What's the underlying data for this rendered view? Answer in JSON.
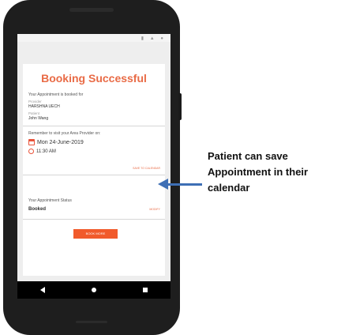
{
  "screen": {
    "title": "Booking Successful",
    "intro": "Your Appointment is booked for",
    "provider_label": "Provider",
    "provider_value": "HARSHNA UECH",
    "patient_label": "Patient",
    "patient_value": "John Wang",
    "reminder": "Remember to visit your Area Provider on:",
    "date": "Mon 24-June-2019",
    "time": "11:30 AM",
    "save_calendar": "SAVE TO CALENDAR",
    "status_label": "Your Appointment Status",
    "status_value": "Booked",
    "status_action": "MODIFY",
    "cta": "BOOK MORE"
  },
  "annotation": {
    "text": "Patient can save Appointment in their calendar"
  },
  "colors": {
    "accent": "#e96b46",
    "button": "#f15a2b",
    "arrow": "#3e6fb5",
    "phone": "#1e1e1e"
  },
  "icons": [
    "calendar-icon",
    "clock-icon",
    "back-icon",
    "home-icon",
    "recent-apps-icon"
  ]
}
